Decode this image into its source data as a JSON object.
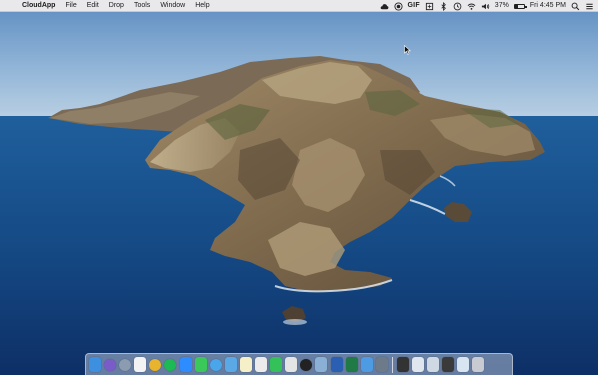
{
  "menubar": {
    "apple_symbol": "",
    "app_name": "CloudApp",
    "menus": [
      "File",
      "Edit",
      "Drop",
      "Tools",
      "Window",
      "Help"
    ],
    "status": {
      "gif_label": "GIF",
      "battery_percent": "37%",
      "battery_level": 0.37,
      "clock": "Fri 4:45 PM"
    }
  },
  "desktop": {
    "wallpaper": "macOS Catalina island"
  },
  "dock": {
    "apps": [
      {
        "name": "finder-icon",
        "color": "#3d8fe0"
      },
      {
        "name": "siri-icon",
        "color": "#7a5cc9"
      },
      {
        "name": "launchpad-icon",
        "color": "#8b9bb0"
      },
      {
        "name": "calendar-icon",
        "color": "#f3f3f3"
      },
      {
        "name": "chrome-icon",
        "color": "#e8b42e"
      },
      {
        "name": "spotify-icon",
        "color": "#1db954"
      },
      {
        "name": "zoom-icon",
        "color": "#2d8cff"
      },
      {
        "name": "messages-icon",
        "color": "#3ac85b"
      },
      {
        "name": "safari-icon",
        "color": "#4aa6ea"
      },
      {
        "name": "mail-icon",
        "color": "#5aa9e6"
      },
      {
        "name": "notes-icon",
        "color": "#f6f0c9"
      },
      {
        "name": "textedit-icon",
        "color": "#ebebeb"
      },
      {
        "name": "facetime-icon",
        "color": "#34c15a"
      },
      {
        "name": "photos-icon",
        "color": "#e4e4e4"
      },
      {
        "name": "screen-recorder-icon",
        "color": "#222222"
      },
      {
        "name": "preview-icon",
        "color": "#8ab0d6"
      },
      {
        "name": "word-icon",
        "color": "#2b5fb4"
      },
      {
        "name": "excel-icon",
        "color": "#1f7a45"
      },
      {
        "name": "xcode-icon",
        "color": "#4d9be3"
      },
      {
        "name": "image-capture-icon",
        "color": "#6c7a8a"
      }
    ],
    "documents": [
      {
        "name": "terminal-icon",
        "color": "#333333"
      },
      {
        "name": "document-stack-icon",
        "color": "#dfe6ee"
      },
      {
        "name": "window-screenshot-icon",
        "color": "#cfd9e3"
      },
      {
        "name": "screen-capture-icon",
        "color": "#3a3a3a"
      },
      {
        "name": "downloads-folder-icon",
        "color": "#d7e4f1"
      },
      {
        "name": "trash-icon",
        "color": "#c8ccd2"
      }
    ]
  }
}
